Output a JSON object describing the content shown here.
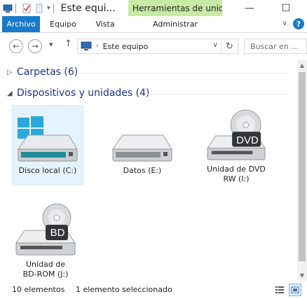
{
  "titlebar": {
    "title": "Este equi...",
    "contextual_tab": "Herramientas de unid...",
    "minimize": "—",
    "maximize": "☐"
  },
  "ribbon": {
    "tabs": [
      "Archivo",
      "Equipo",
      "Vista",
      "Administrar"
    ],
    "help": "?"
  },
  "nav": {
    "address": "Este equipo",
    "search_placeholder": "Buscar en ..."
  },
  "groups": {
    "folders": {
      "label": "Carpetas (6)",
      "expanded": false
    },
    "devices": {
      "label": "Dispositivos y unidades (4)",
      "expanded": true
    }
  },
  "drives": [
    {
      "label": "Disco local (C:)",
      "kind": "system-drive",
      "selected": true
    },
    {
      "label": "Datos (E:)",
      "kind": "hard-drive",
      "selected": false
    },
    {
      "label": "Unidad de DVD RW (I:)",
      "kind": "dvd-drive",
      "badge": "DVD",
      "selected": false
    },
    {
      "label": "Unidad de BD-ROM (J:)",
      "kind": "bd-drive",
      "badge": "BD",
      "selected": false
    }
  ],
  "status": {
    "count": "10 elementos",
    "selection": "1 elemento seleccionado"
  },
  "colors": {
    "accent": "#1979ca",
    "contextual_tab": "#c7eaa4",
    "group_text": "#1e3287",
    "selection": "#e5f3ff"
  }
}
